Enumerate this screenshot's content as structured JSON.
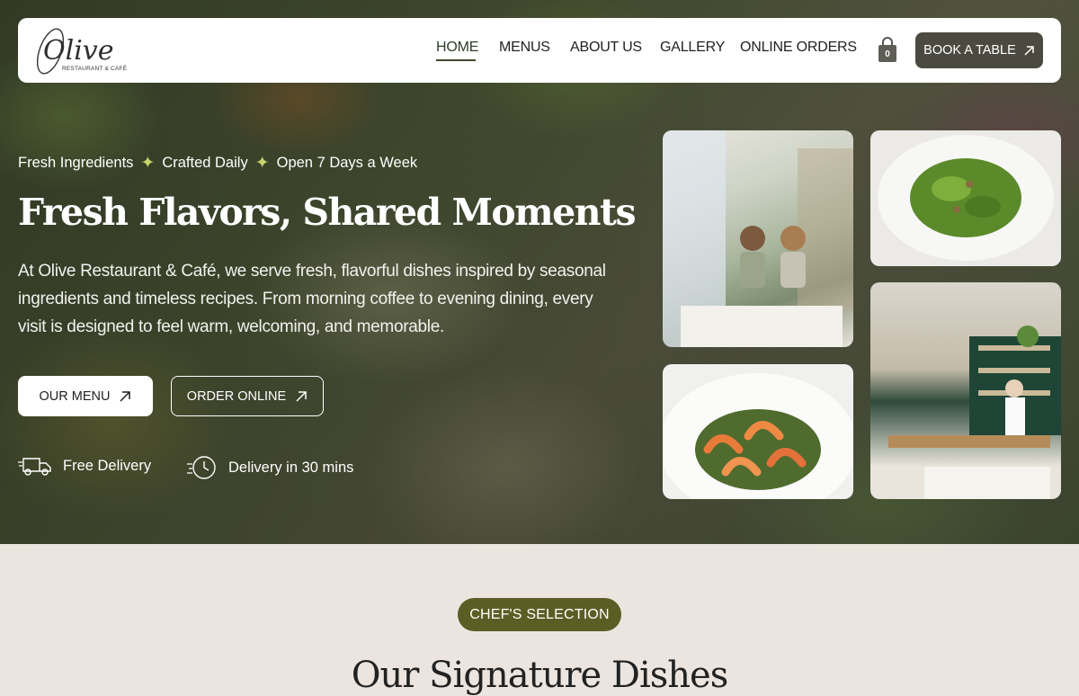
{
  "brand": {
    "logo_word": "Olive",
    "logo_sub": "RESTAURANT & CAFÉ"
  },
  "nav": {
    "items": [
      {
        "label": "HOME",
        "active": true
      },
      {
        "label": "MENUS"
      },
      {
        "label": "ABOUT US"
      },
      {
        "label": "GALLERY"
      },
      {
        "label": "ONLINE ORDERS"
      }
    ],
    "cart_count": "0",
    "cart_icon": "shopping-bag-icon",
    "book_label": "BOOK A TABLE",
    "book_icon": "arrow-up-right-icon"
  },
  "hero": {
    "tags": [
      "Fresh Ingredients",
      "Crafted Daily",
      "Open 7 Days a Week"
    ],
    "separator_icon": "sparkle-icon",
    "headline": "Fresh Flavors, Shared Moments",
    "description": "At Olive Restaurant & Café, we serve fresh, flavorful dishes inspired by seasonal ingredients and timeless recipes. From morning coffee to evening dining, every visit is designed to feel warm, welcoming, and memorable.",
    "primary_button": "OUR MENU",
    "secondary_button": "ORDER ONLINE",
    "features": [
      {
        "icon": "delivery-truck-icon",
        "label": "Free Delivery"
      },
      {
        "icon": "clock-speed-icon",
        "label": "Delivery in 30 mins"
      }
    ]
  },
  "section": {
    "badge": "CHEF'S SELECTION",
    "title": "Our Signature Dishes"
  },
  "colors": {
    "accent_dark": "#4b4a40",
    "olive_badge": "#5c5d24",
    "section_bg": "#ece5df",
    "sparkle": "#c8d36a"
  }
}
